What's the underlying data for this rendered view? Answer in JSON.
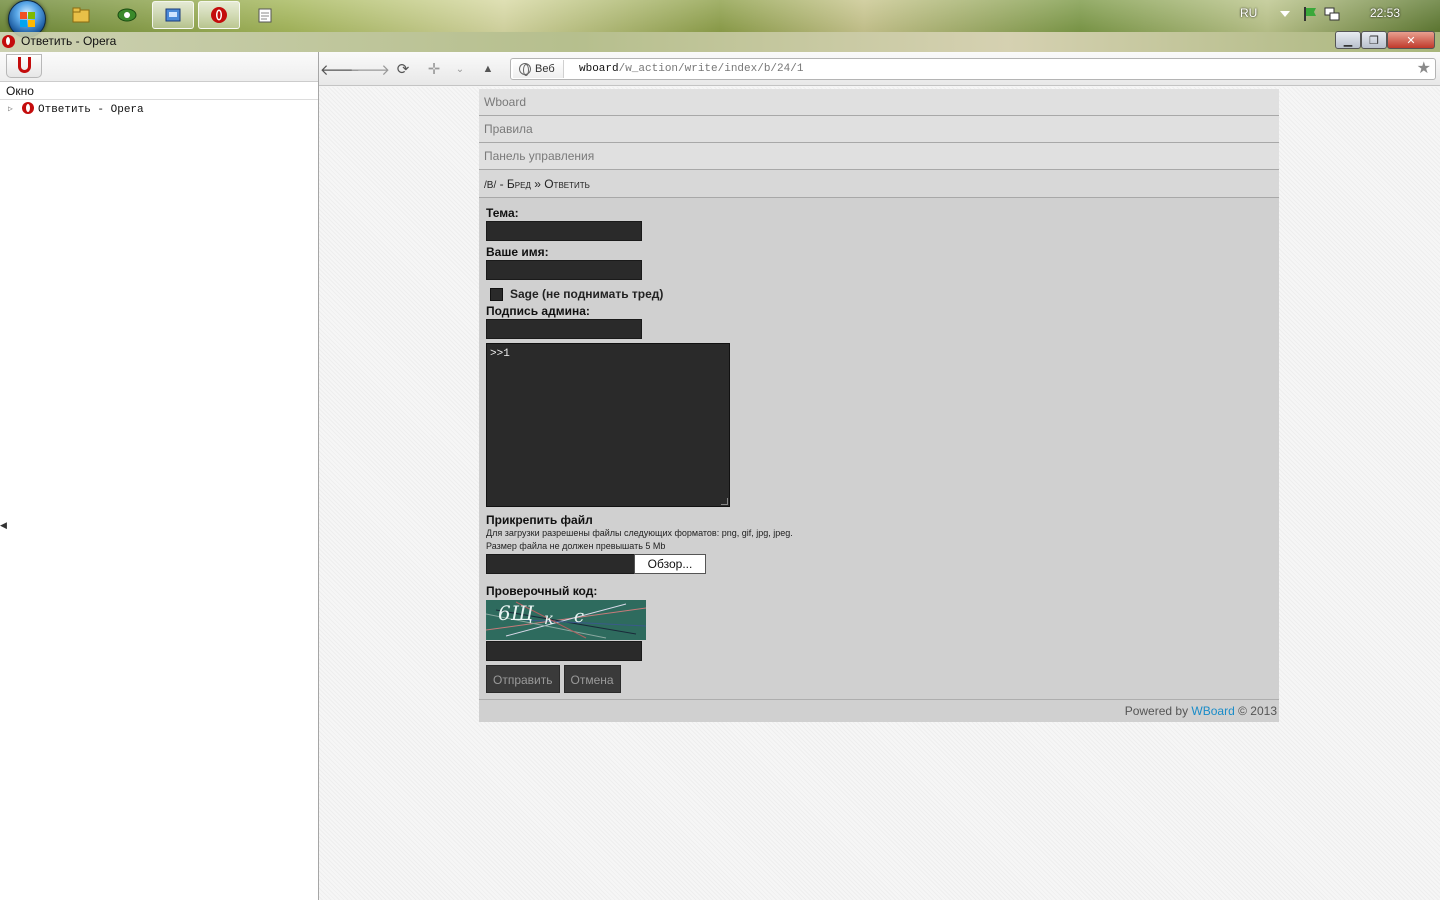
{
  "taskbar": {
    "lang": "RU",
    "clock": "22:53"
  },
  "window": {
    "title": "Ответить - Opera"
  },
  "panel": {
    "header": "Окно",
    "tree_item": "Ответить - Opera"
  },
  "toolbar": {
    "badge": "Веб",
    "url_host": "wboard",
    "url_path": "/w_action/write/index/b/24/1"
  },
  "board": {
    "menu": [
      "Wboard",
      "Правила",
      "Панель управления"
    ],
    "crumb_board": "/B/",
    "crumb_sep1": " - ",
    "crumb_name": "Бред",
    "crumb_sep2": " » ",
    "crumb_action": "Ответить"
  },
  "form": {
    "subject_label": "Тема:",
    "name_label": "Ваше имя:",
    "sage_label": "Sage (не поднимать тред)",
    "admin_sig_label": "Подпись админа:",
    "message_value": ">>1",
    "attach_label": "Прикрепить файл",
    "attach_formats": "Для загрузки разрешены файлы следующих форматов: png, gif, jpg, jpeg.",
    "attach_size": "Размер файла не должен превышать 5 Mb",
    "browse_label": "Обзор...",
    "captcha_label": "Проверочный код:",
    "submit_label": "Отправить",
    "cancel_label": "Отмена"
  },
  "footer": {
    "powered": "Powered by",
    "link": "WBoard",
    "year": "© 2013"
  },
  "colors": {
    "link": "#1a8cc8",
    "opera_red": "#c40c0c",
    "field_bg": "#2a2a2a"
  }
}
